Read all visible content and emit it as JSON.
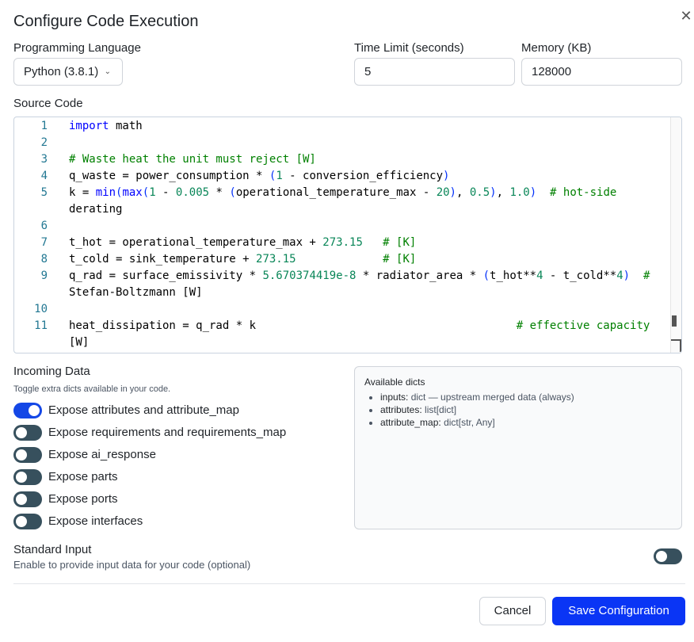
{
  "dialog": {
    "title": "Configure Code Execution",
    "close_icon": "close-icon"
  },
  "language": {
    "label": "Programming Language",
    "value": "Python (3.8.1)"
  },
  "time_limit": {
    "label": "Time Limit (seconds)",
    "value": "5"
  },
  "memory": {
    "label": "Memory (KB)",
    "value": "128000"
  },
  "source": {
    "label": "Source Code",
    "lines": [
      {
        "n": "1",
        "t": "import math"
      },
      {
        "n": "2",
        "t": ""
      },
      {
        "n": "3",
        "t": "# Waste heat the unit must reject [W]"
      },
      {
        "n": "4",
        "t": "q_waste = power_consumption * (1 - conversion_efficiency)"
      },
      {
        "n": "5",
        "t": "k = min(max(1 - 0.005 * (operational_temperature_max - 20), 0.5), 1.0)  # hot-side"
      },
      {
        "n": "",
        "t": "derating"
      },
      {
        "n": "6",
        "t": ""
      },
      {
        "n": "7",
        "t": "t_hot = operational_temperature_max + 273.15   # [K]"
      },
      {
        "n": "8",
        "t": "t_cold = sink_temperature + 273.15             # [K]"
      },
      {
        "n": "9",
        "t": "q_rad = surface_emissivity * 5.670374419e-8 * radiator_area * (t_hot**4 - t_cold**4)  #"
      },
      {
        "n": "",
        "t": "Stefan-Boltzmann [W]"
      },
      {
        "n": "10",
        "t": ""
      },
      {
        "n": "11",
        "t": "heat_dissipation = q_rad * k                                       # effective capacity"
      },
      {
        "n": "",
        "t": "[W]"
      }
    ]
  },
  "incoming": {
    "title": "Incoming Data",
    "subtitle": "Toggle extra dicts available in your code.",
    "toggles": [
      {
        "label": "Expose attributes and attribute_map",
        "on": true
      },
      {
        "label": "Expose requirements and requirements_map",
        "on": false
      },
      {
        "label": "Expose ai_response",
        "on": false
      },
      {
        "label": "Expose parts",
        "on": false
      },
      {
        "label": "Expose ports",
        "on": false
      },
      {
        "label": "Expose interfaces",
        "on": false
      }
    ]
  },
  "available": {
    "title": "Available dicts",
    "items": [
      {
        "key": "inputs:",
        "desc": "dict — upstream merged data (always)"
      },
      {
        "key": "attributes:",
        "desc": "list[dict]"
      },
      {
        "key": "attribute_map:",
        "desc": "dict[str, Any]"
      }
    ]
  },
  "stdin": {
    "title": "Standard Input",
    "subtitle": "Enable to provide input data for your code (optional)",
    "on": false
  },
  "footer": {
    "cancel_label": "Cancel",
    "save_label": "Save Configuration"
  },
  "colors": {
    "primary": "#0a35f5",
    "toggle_off": "#37505d",
    "toggle_on": "#1447e6"
  }
}
